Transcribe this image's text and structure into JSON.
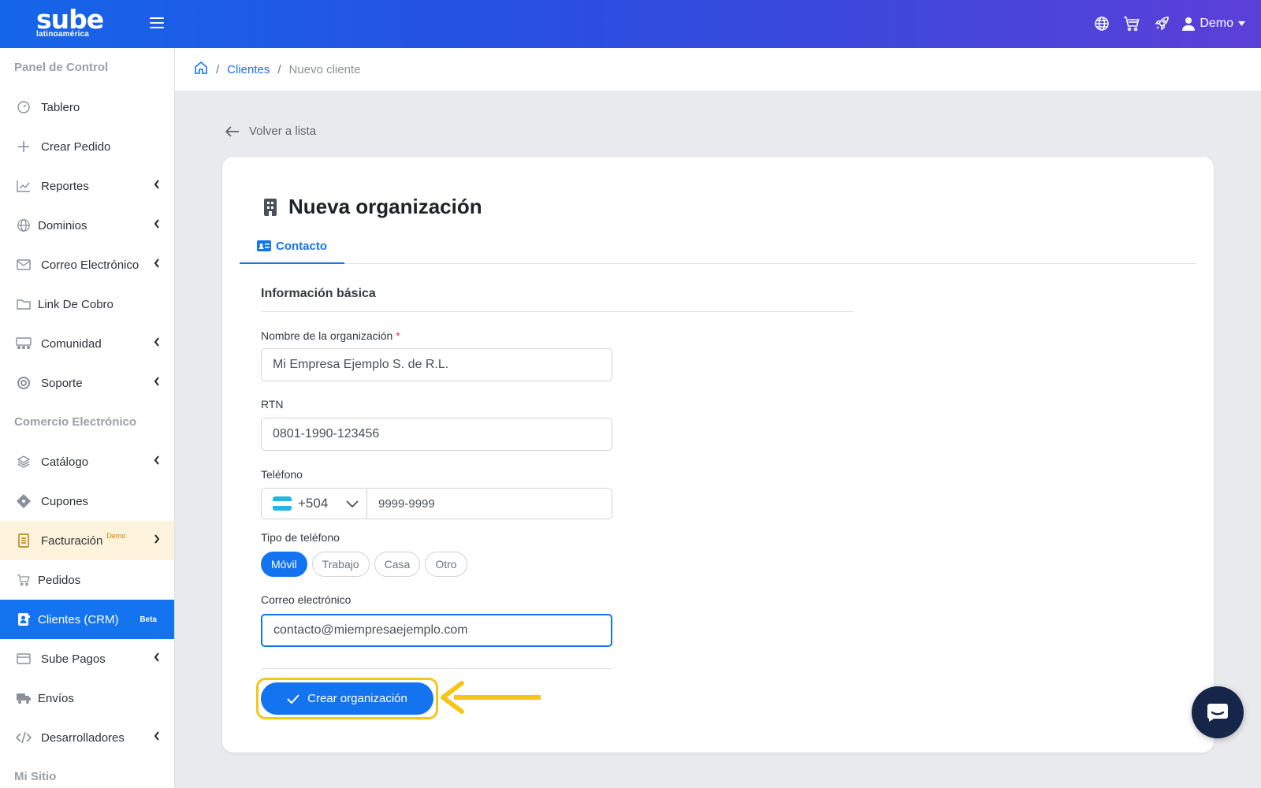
{
  "topbar": {
    "logo_main": "sube",
    "logo_sub": "latinoamérica",
    "user_label": "Demo",
    "icons": [
      "globe-icon",
      "cart-icon",
      "rocket-icon",
      "user-icon"
    ]
  },
  "sidebar": {
    "sections": [
      {
        "title": "Panel de Control"
      },
      {
        "title": "Comercio Electrónico"
      },
      {
        "title": "Mi Sitio"
      }
    ],
    "items": [
      {
        "label": "Tablero",
        "icon": "gauge-icon"
      },
      {
        "label": "Crear Pedido",
        "icon": "plus-icon"
      },
      {
        "label": "Reportes",
        "icon": "chart-icon"
      },
      {
        "label": "Dominios",
        "icon": "globe-icon"
      },
      {
        "label": "Correo Electrónico",
        "icon": "envelope-icon"
      },
      {
        "label": "Link De Cobro",
        "icon": "folder-icon"
      },
      {
        "label": "Comunidad",
        "icon": "community-icon"
      },
      {
        "label": "Soporte",
        "icon": "lifebuoy-icon"
      },
      {
        "label": "Catálogo",
        "icon": "layers-icon"
      },
      {
        "label": "Cupones",
        "icon": "tag-icon"
      },
      {
        "label": "Facturación",
        "sup": "Demo",
        "icon": "invoice-icon"
      },
      {
        "label": "Pedidos",
        "icon": "cart-icon"
      },
      {
        "label": "Clientes (CRM)",
        "badge": "Beta",
        "icon": "contact-icon"
      },
      {
        "label": "Sube Pagos",
        "icon": "card-icon"
      },
      {
        "label": "Envíos",
        "icon": "truck-icon"
      },
      {
        "label": "Desarrolladores",
        "icon": "code-icon"
      }
    ]
  },
  "breadcrumb": {
    "sep": "/",
    "link": "Clientes",
    "current": "Nuevo cliente"
  },
  "back_label": "Volver a lista",
  "card": {
    "title": "Nueva organización",
    "tab": "Contacto",
    "section": "Información básica",
    "fields": {
      "name_label": "Nombre de la organización",
      "required": "*",
      "name_value": "Mi Empresa Ejemplo S. de R.L.",
      "rtn_label": "RTN",
      "rtn_value": "0801-1990-123456",
      "phone_label": "Teléfono",
      "phone_code": "+504",
      "phone_value": "9999-9999",
      "phone_type_label": "Tipo de teléfono",
      "phone_types": [
        "Móvil",
        "Trabajo",
        "Casa",
        "Otro"
      ],
      "email_label": "Correo electrónico",
      "email_value": "contacto@miempresaejemplo.com"
    },
    "submit_label": "Crear organización"
  },
  "colors": {
    "primary": "#1474f0",
    "highlight": "#f5c518",
    "chat": "#16264a"
  }
}
